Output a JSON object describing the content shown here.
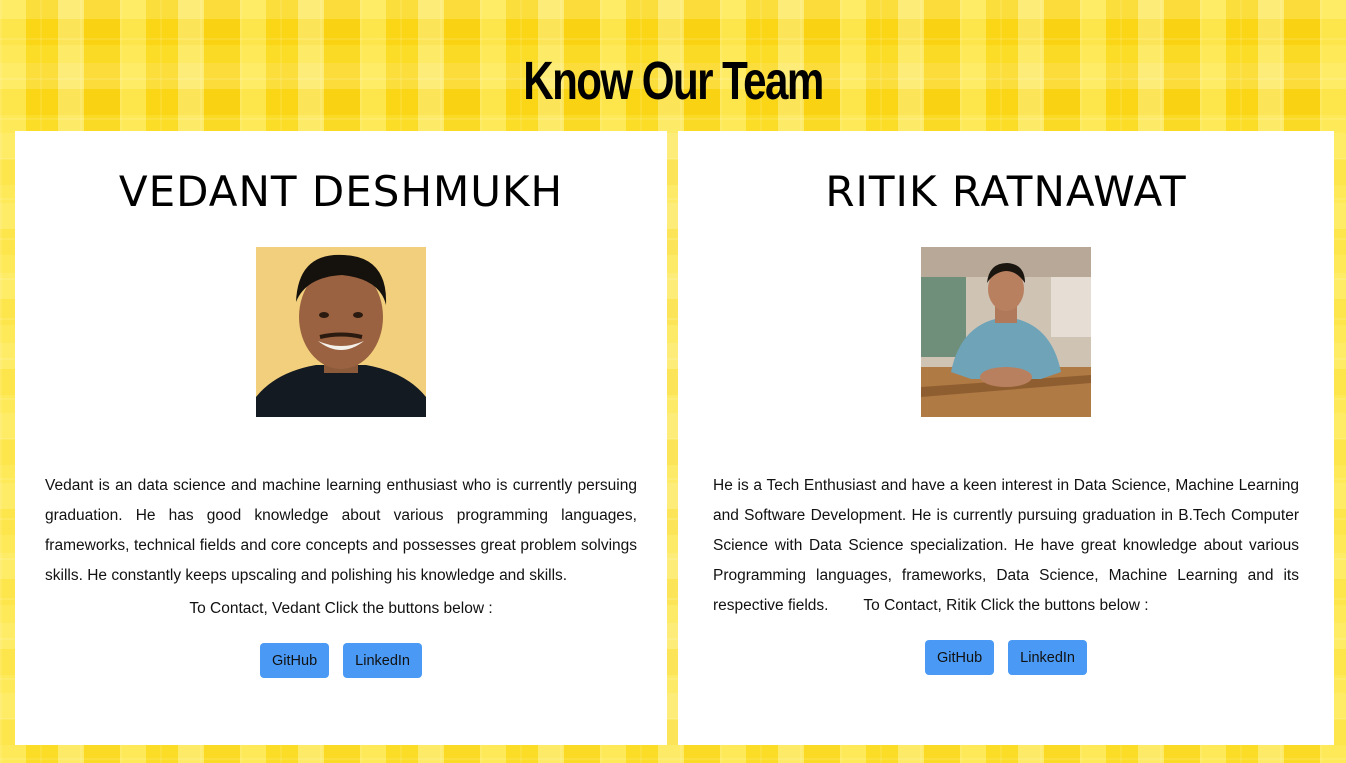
{
  "page": {
    "title": "Know Our Team"
  },
  "team": [
    {
      "name": "VEDANT DESHMUKH",
      "bio": "Vedant is an data science and machine learning enthusiast who is currently persuing graduation. He has good knowledge about various programming languages, frameworks, technical fields and core concepts and possesses great problem solvings skills. He constantly keeps upscaling and polishing his knowledge and skills.",
      "contact_text": "To Contact, Vedant Click the buttons below :",
      "buttons": [
        "GitHub",
        "LinkedIn"
      ],
      "photo_bg": "#f2cf7c"
    },
    {
      "name": "RITIK RATNAWAT",
      "bio": "He is a Tech Enthusiast and have a keen interest in Data Science, Machine Learning and Software Development. He is currently pursuing graduation in B.Tech Computer Science with Data Science specialization. He have great knowledge about various Programming languages, frameworks, Data Science, Machine Learning and its respective fields.",
      "contact_text": "To Contact, Ritik Click the buttons below :",
      "buttons": [
        "GitHub",
        "LinkedIn"
      ],
      "photo_bg": "#b88658"
    }
  ],
  "colors": {
    "background": "#fbdc1a",
    "button": "#4a9af5",
    "card": "#ffffff"
  }
}
